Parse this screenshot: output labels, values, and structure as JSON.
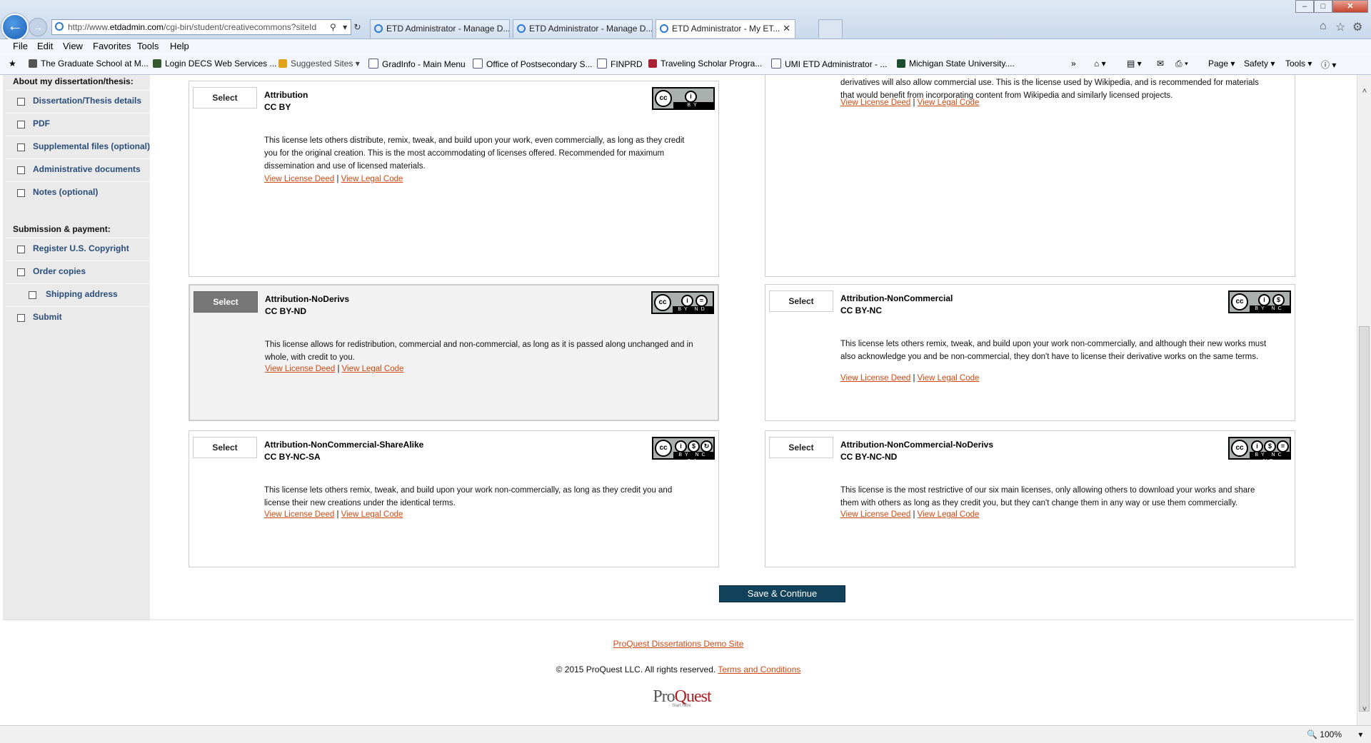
{
  "browser": {
    "address_prefix": "http://www.",
    "address_domain": "etdadmin.com",
    "address_path": "/cgi-bin/student/creativecommons?siteId",
    "tabs": [
      {
        "label": "ETD Administrator - Manage D..."
      },
      {
        "label": "ETD Administrator - Manage D..."
      },
      {
        "label": "ETD Administrator - My ET..."
      }
    ],
    "menu": [
      "File",
      "Edit",
      "View",
      "Favorites",
      "Tools",
      "Help"
    ],
    "favorites": [
      {
        "label": "The Graduate School at M..."
      },
      {
        "label": "Login DECS Web Services ..."
      },
      {
        "label": "Suggested Sites ▾"
      },
      {
        "label": "GradInfo - Main Menu"
      },
      {
        "label": "Office of Postsecondary S..."
      },
      {
        "label": "FINPRD"
      },
      {
        "label": "Traveling Scholar Progra..."
      },
      {
        "label": "UMI ETD Administrator - ..."
      },
      {
        "label": "Michigan State University...."
      }
    ],
    "commands": {
      "page": "Page ▾",
      "safety": "Safety ▾",
      "tools": "Tools ▾"
    },
    "zoom": "100%"
  },
  "sidebar": {
    "section1_heading": "About my dissertation/thesis:",
    "section1_items": [
      {
        "label": "Dissertation/Thesis details"
      },
      {
        "label": "PDF"
      },
      {
        "label": "Supplemental files (optional)"
      },
      {
        "label": "Administrative documents"
      },
      {
        "label": "Notes (optional)"
      }
    ],
    "section2_heading": "Submission & payment:",
    "section2_items": [
      {
        "label": "Register U.S. Copyright"
      },
      {
        "label": "Order copies"
      },
      {
        "label": "Shipping address"
      },
      {
        "label": "Submit"
      }
    ]
  },
  "licenses": {
    "select_label": "Select",
    "deed_label": "View License Deed",
    "legal_label": "View Legal Code",
    "separator": "|",
    "partial_right_text": "derivatives will also allow commercial use. This is the license used by Wikipedia, and is recommended for materials that would benefit from incorporating content from Wikipedia and similarly licensed projects.",
    "items": [
      {
        "name": "Attribution",
        "code": "CC BY",
        "badge": "BY",
        "selected": false,
        "description": "This license lets others distribute, remix, tweak, and build upon your work, even commercially, as long as they credit you for the original creation. This is the most accommodating of licenses offered. Recommended for maximum dissemination and use of licensed materials."
      },
      {
        "name": "Attribution-NoDerivs",
        "code": "CC BY-ND",
        "badge": "BY  ND",
        "selected": true,
        "description": "This license allows for redistribution, commercial and non-commercial, as long as it is passed along unchanged and in whole, with credit to you."
      },
      {
        "name": "Attribution-NonCommercial",
        "code": "CC BY-NC",
        "badge": "BY  NC",
        "selected": false,
        "description": "This license lets others remix, tweak, and build upon your work non-commercially, and although their new works must also acknowledge you and be non-commercial, they don't have to license their derivative works on the same terms."
      },
      {
        "name": "Attribution-NonCommercial-ShareAlike",
        "code": "CC BY-NC-SA",
        "badge": "BY NC SA",
        "selected": false,
        "description": "This license lets others remix, tweak, and build upon your work non-commercially, as long as they credit you and license their new creations under the identical terms."
      },
      {
        "name": "Attribution-NonCommercial-NoDerivs",
        "code": "CC BY-NC-ND",
        "badge": "BY NC ND",
        "selected": false,
        "description": "This license is the most restrictive of our six main licenses, only allowing others to download your works and share them with others as long as they credit you, but they can't change them in any way or use them commercially."
      }
    ]
  },
  "save_button": "Save & Continue",
  "footer": {
    "demo_link": "ProQuest Dissertations Demo Site",
    "copyright": "© 2015 ProQuest LLC. All rights reserved.",
    "terms_link": "Terms and Conditions",
    "logo_pro": "Pro",
    "logo_quest": "Quest",
    "logo_tag": "Start here."
  },
  "colors": {
    "link": "#d04a14",
    "save_button": "#12415a",
    "sidebar_link": "#2a4d7a",
    "selected_button": "#777777"
  }
}
